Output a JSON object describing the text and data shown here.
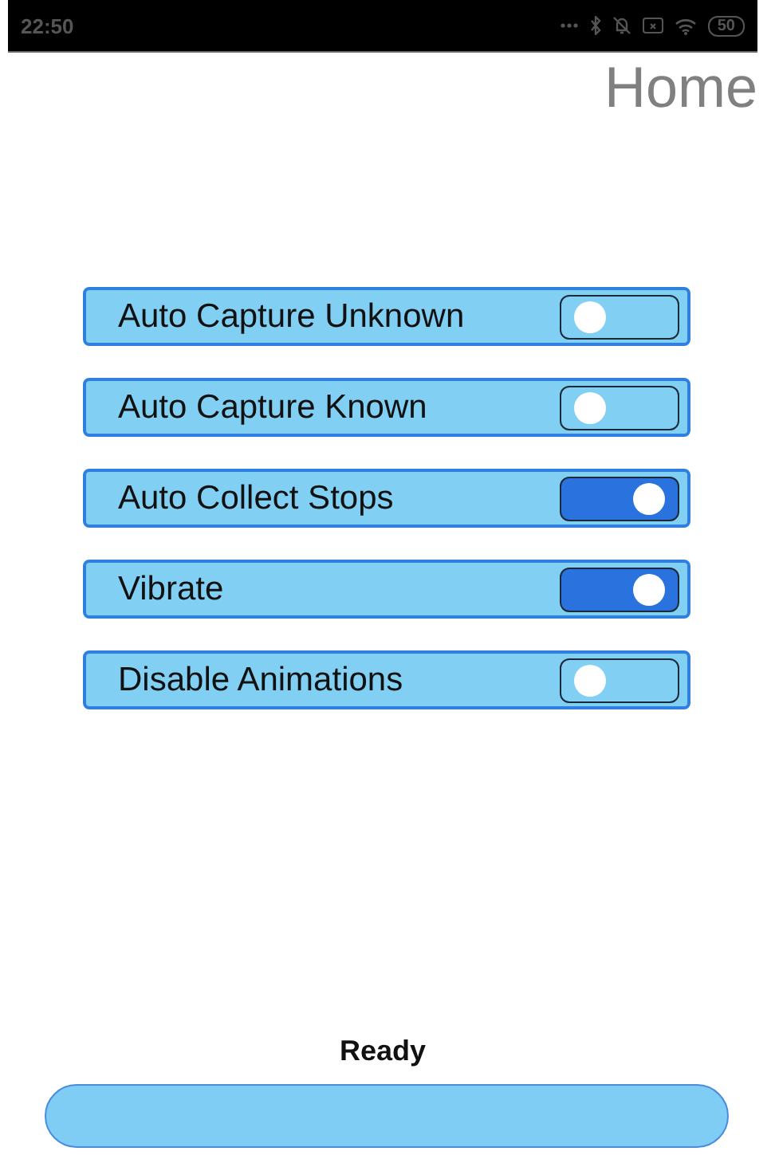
{
  "status_bar": {
    "time": "22:50",
    "battery": "50"
  },
  "title": "Home",
  "settings": [
    {
      "label": "Auto Capture Unknown",
      "on": false
    },
    {
      "label": "Auto Capture Known",
      "on": false
    },
    {
      "label": "Auto Collect Stops",
      "on": true
    },
    {
      "label": "Vibrate",
      "on": true
    },
    {
      "label": "Disable Animations",
      "on": false
    }
  ],
  "status": "Ready"
}
